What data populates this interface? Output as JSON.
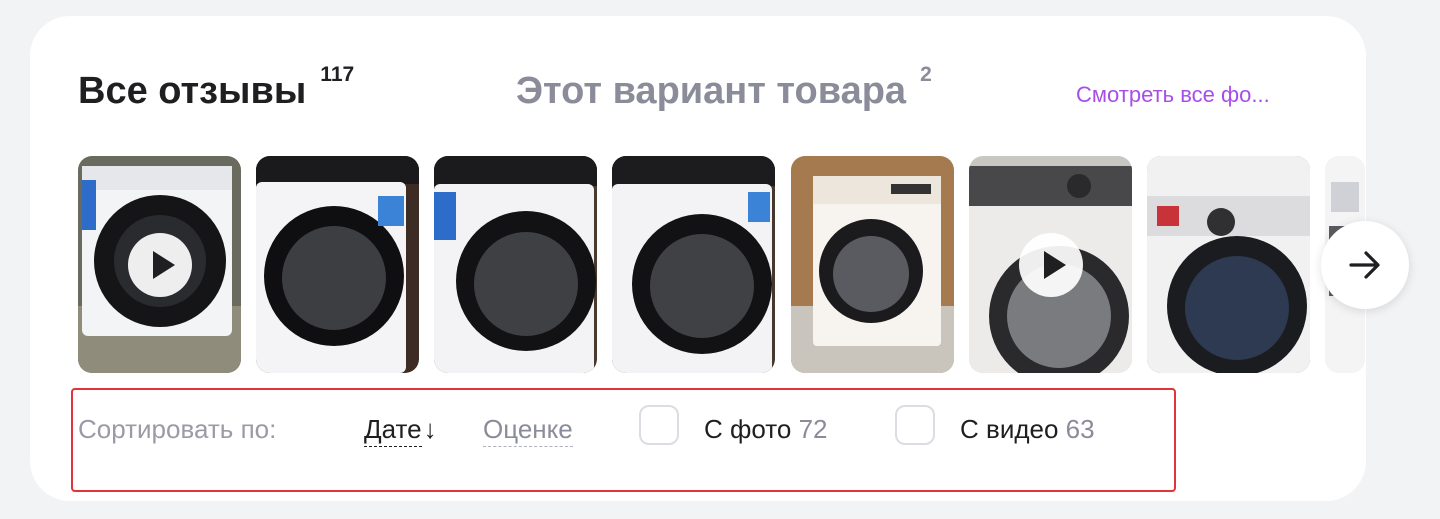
{
  "header": {
    "all_reviews_label": "Все отзывы",
    "all_reviews_count": "117",
    "variant_label": "Этот вариант товара",
    "variant_count": "2",
    "see_all_photos": "Смотреть все фо..."
  },
  "gallery": {
    "items": [
      {
        "type": "video",
        "icon": "play-icon"
      },
      {
        "type": "photo"
      },
      {
        "type": "photo"
      },
      {
        "type": "photo"
      },
      {
        "type": "photo"
      },
      {
        "type": "video",
        "icon": "play-icon"
      },
      {
        "type": "photo"
      },
      {
        "type": "photo"
      }
    ],
    "next_icon": "arrow-right-icon"
  },
  "filters": {
    "sort_label": "Сортировать по:",
    "sort_date": "Дате",
    "sort_date_arrow": "↓",
    "sort_rating": "Оценке",
    "with_photo_label": "С фото",
    "with_photo_count": "72",
    "with_video_label": "С видео",
    "with_video_count": "63"
  },
  "colors": {
    "accent_link": "#a84ee8",
    "highlight_border": "#e2333b",
    "muted_text": "#8b8c99"
  }
}
